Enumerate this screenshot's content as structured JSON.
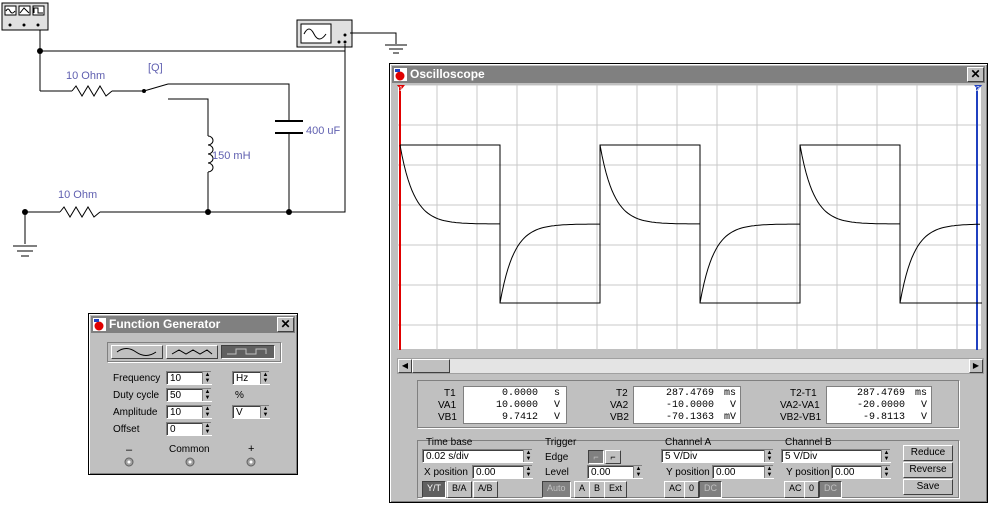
{
  "circuit": {
    "r1_label": "10  Ohm",
    "r2_label": "10  Ohm",
    "switch_label": "[Q]",
    "inductor_label": "150 mH",
    "capacitor_label": "400 uF"
  },
  "function_generator": {
    "title": "Function Generator",
    "frequency_label": "Frequency",
    "frequency_value": "10",
    "frequency_unit": "Hz",
    "duty_label": "Duty cycle",
    "duty_value": "50",
    "duty_unit": "%",
    "amplitude_label": "Amplitude",
    "amplitude_value": "10",
    "amplitude_unit": "V",
    "offset_label": "Offset",
    "offset_value": "0",
    "minus": "–",
    "common": "Common",
    "plus": "+"
  },
  "oscilloscope": {
    "title": "Oscilloscope",
    "cursor1": "1",
    "cursor2": "2",
    "readouts": {
      "t1_label": "T1",
      "t1_value": "0.0000",
      "t1_unit": "s",
      "va1_label": "VA1",
      "va1_value": "10.0000",
      "va1_unit": "V",
      "vb1_label": "VB1",
      "vb1_value": "9.7412",
      "vb1_unit": "V",
      "t2_label": "T2",
      "t2_value": "287.4769",
      "t2_unit": "ms",
      "va2_label": "VA2",
      "va2_value": "-10.0000",
      "va2_unit": "V",
      "vb2_label": "VB2",
      "vb2_value": "-70.1363",
      "vb2_unit": "mV",
      "dt_label": "T2-T1",
      "dt_value": "287.4769",
      "dt_unit": "ms",
      "dva_label": "VA2-VA1",
      "dva_value": "-20.0000",
      "dva_unit": "V",
      "dvb_label": "VB2-VB1",
      "dvb_value": "-9.8113",
      "dvb_unit": "V"
    },
    "timebase": {
      "title": "Time base",
      "value": "0.02 s/div",
      "xpos_label": "X position",
      "xpos_value": "0.00",
      "yt": "Y/T",
      "ba": "B/A",
      "ab": "A/B"
    },
    "trigger": {
      "title": "Trigger",
      "edge_label": "Edge",
      "level_label": "Level",
      "level_value": "0.00",
      "auto": "Auto",
      "a": "A",
      "b": "B",
      "ext": "Ext"
    },
    "channel_a": {
      "title": "Channel A",
      "value": "5 V/Div",
      "ypos_label": "Y position",
      "ypos_value": "0.00",
      "ac": "AC",
      "zero": "0",
      "dc": "DC"
    },
    "channel_b": {
      "title": "Channel B",
      "value": "5 V/Div",
      "ypos_label": "Y position",
      "ypos_value": "0.00",
      "ac": "AC",
      "zero": "0",
      "dc": "DC"
    },
    "buttons": {
      "reduce": "Reduce",
      "reverse": "Reverse",
      "save": "Save"
    }
  }
}
